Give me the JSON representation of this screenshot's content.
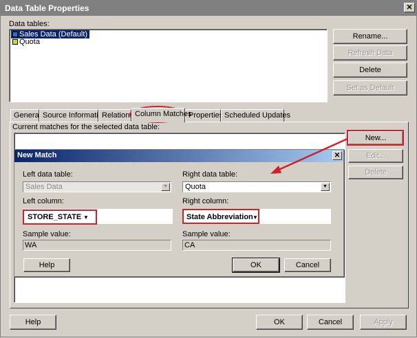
{
  "window": {
    "title": "Data Table Properties"
  },
  "data_tables": {
    "label": "Data tables:",
    "items": [
      {
        "name": "Sales Data (Default)",
        "color": "#2a6fd6",
        "selected": true
      },
      {
        "name": "Quota",
        "color": "#c8e020",
        "selected": false
      }
    ]
  },
  "side_buttons": {
    "rename": "Rename...",
    "refresh": "Refresh Data",
    "delete": "Delete",
    "set_default": "Set as Default"
  },
  "tabs": [
    "General",
    "Source Information",
    "Relations",
    "Column Matches",
    "Properties",
    "Scheduled Updates"
  ],
  "active_tab": "Column Matches",
  "column_matches": {
    "label": "Current matches for the selected data table:",
    "new": "New...",
    "edit": "Edit...",
    "delete": "Delete"
  },
  "new_match": {
    "title": "New Match",
    "left_table_label": "Left data table:",
    "left_table_value": "Sales Data",
    "right_table_label": "Right data table:",
    "right_table_value": "Quota",
    "left_column_label": "Left column:",
    "left_column_value": "STORE_STATE",
    "right_column_label": "Right column:",
    "right_column_value": "State Abbreviation",
    "left_sample_label": "Sample value:",
    "left_sample_value": "WA",
    "right_sample_label": "Sample value:",
    "right_sample_value": "CA",
    "help": "Help",
    "ok": "OK",
    "cancel": "Cancel"
  },
  "footer": {
    "help": "Help",
    "ok": "OK",
    "cancel": "Cancel",
    "apply": "Apply"
  },
  "colors": {
    "annotation_red": "#d0202a",
    "selection_blue": "#0a246a"
  }
}
